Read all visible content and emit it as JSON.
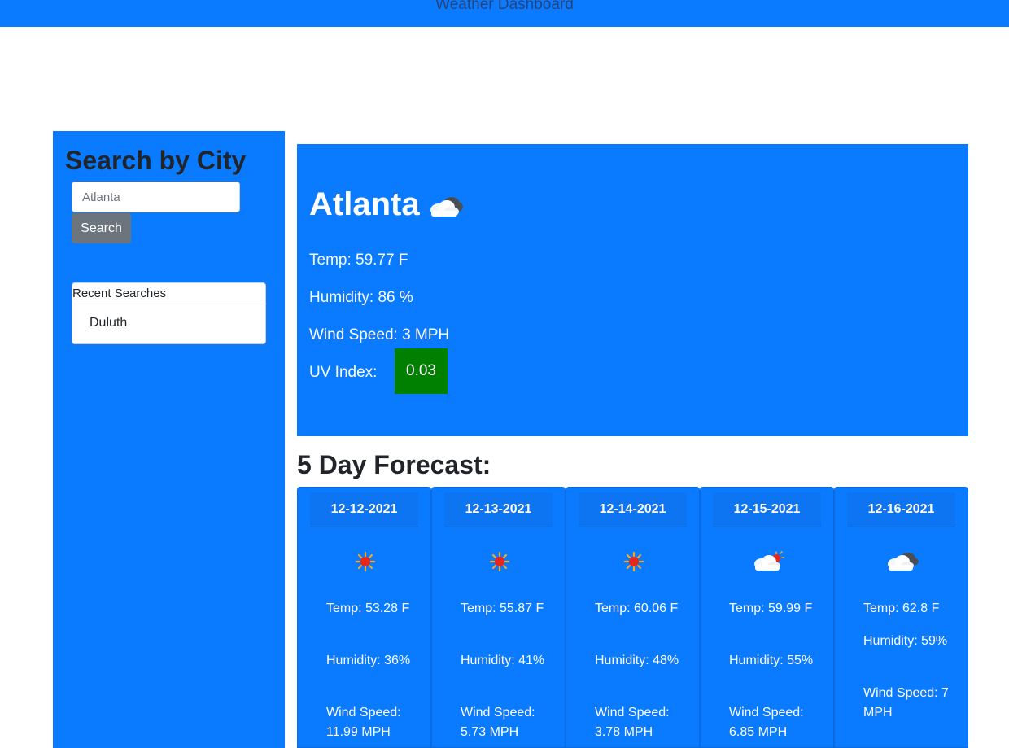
{
  "header": {
    "title": "Weather Dashboard"
  },
  "sidebar": {
    "heading": "Search by City",
    "search": {
      "value": "",
      "placeholder": "Atlanta"
    },
    "search_button": "Search",
    "recent": {
      "title": "Recent Searches",
      "items": [
        "Duluth"
      ]
    }
  },
  "current": {
    "city": "Atlanta",
    "icon": "cloud-icon",
    "temp": "Temp: 59.77 F",
    "humidity": "Humidity: 86 %",
    "wind": "Wind Speed: 3 MPH",
    "uv_label": "UV Index:",
    "uv_value": "0.03",
    "uv_color": "#008000"
  },
  "forecast": {
    "title": "5 Day Forecast:",
    "days": [
      {
        "date": "12-12-2021",
        "icon": "sun-icon",
        "temp": "Temp: 53.28 F",
        "humidity": "Humidity: 36%",
        "wind": "Wind Speed: 11.99 MPH"
      },
      {
        "date": "12-13-2021",
        "icon": "sun-icon",
        "temp": "Temp: 55.87 F",
        "humidity": "Humidity: 41%",
        "wind": "Wind Speed: 5.73 MPH"
      },
      {
        "date": "12-14-2021",
        "icon": "sun-icon",
        "temp": "Temp: 60.06 F",
        "humidity": "Humidity: 48%",
        "wind": "Wind Speed: 3.78 MPH"
      },
      {
        "date": "12-15-2021",
        "icon": "partly-cloudy-icon",
        "temp": "Temp: 59.99 F",
        "humidity": "Humidity: 55%",
        "wind": "Wind Speed: 6.85 MPH"
      },
      {
        "date": "12-16-2021",
        "icon": "cloud-icon",
        "temp": "Temp: 62.8 F",
        "humidity": "Humidity: 59%",
        "wind": "Wind Speed: 7 MPH"
      }
    ]
  },
  "colors": {
    "brand_blue": "#0a7bff",
    "button_gray": "#6c757d",
    "uv_green": "#008000"
  }
}
